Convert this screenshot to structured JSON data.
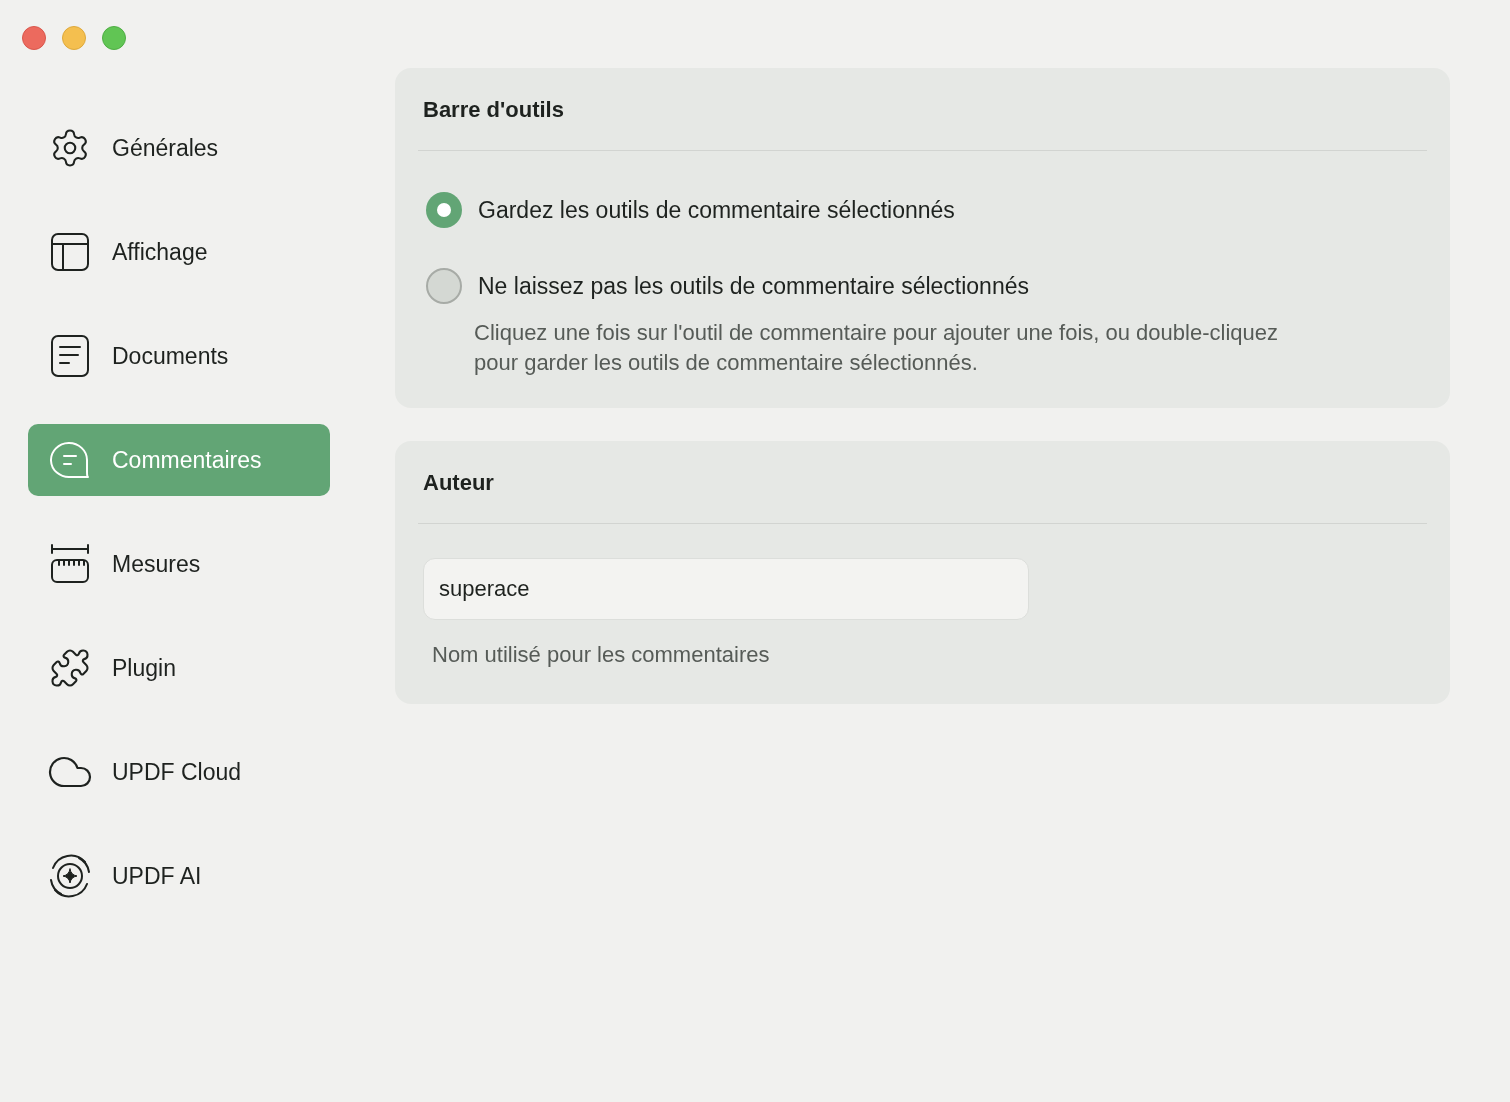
{
  "sidebar": {
    "items": [
      {
        "label": "Générales",
        "selected": false
      },
      {
        "label": "Affichage",
        "selected": false
      },
      {
        "label": "Documents",
        "selected": false
      },
      {
        "label": "Commentaires",
        "selected": true
      },
      {
        "label": "Mesures",
        "selected": false
      },
      {
        "label": "Plugin",
        "selected": false
      },
      {
        "label": "UPDF Cloud",
        "selected": false
      },
      {
        "label": "UPDF AI",
        "selected": false
      }
    ]
  },
  "toolbar_section": {
    "title": "Barre d'outils",
    "options": [
      {
        "label": "Gardez les outils de commentaire sélectionnés",
        "selected": true
      },
      {
        "label": "Ne laissez pas les outils de commentaire sélectionnés",
        "selected": false,
        "description": "Cliquez une fois sur l'outil de commentaire pour ajouter une fois, ou double-cliquez pour garder les outils de commentaire sélectionnés."
      }
    ]
  },
  "author_section": {
    "title": "Auteur",
    "field": {
      "value": "superace"
    },
    "hint": "Nom utilisé pour les commentaires"
  }
}
